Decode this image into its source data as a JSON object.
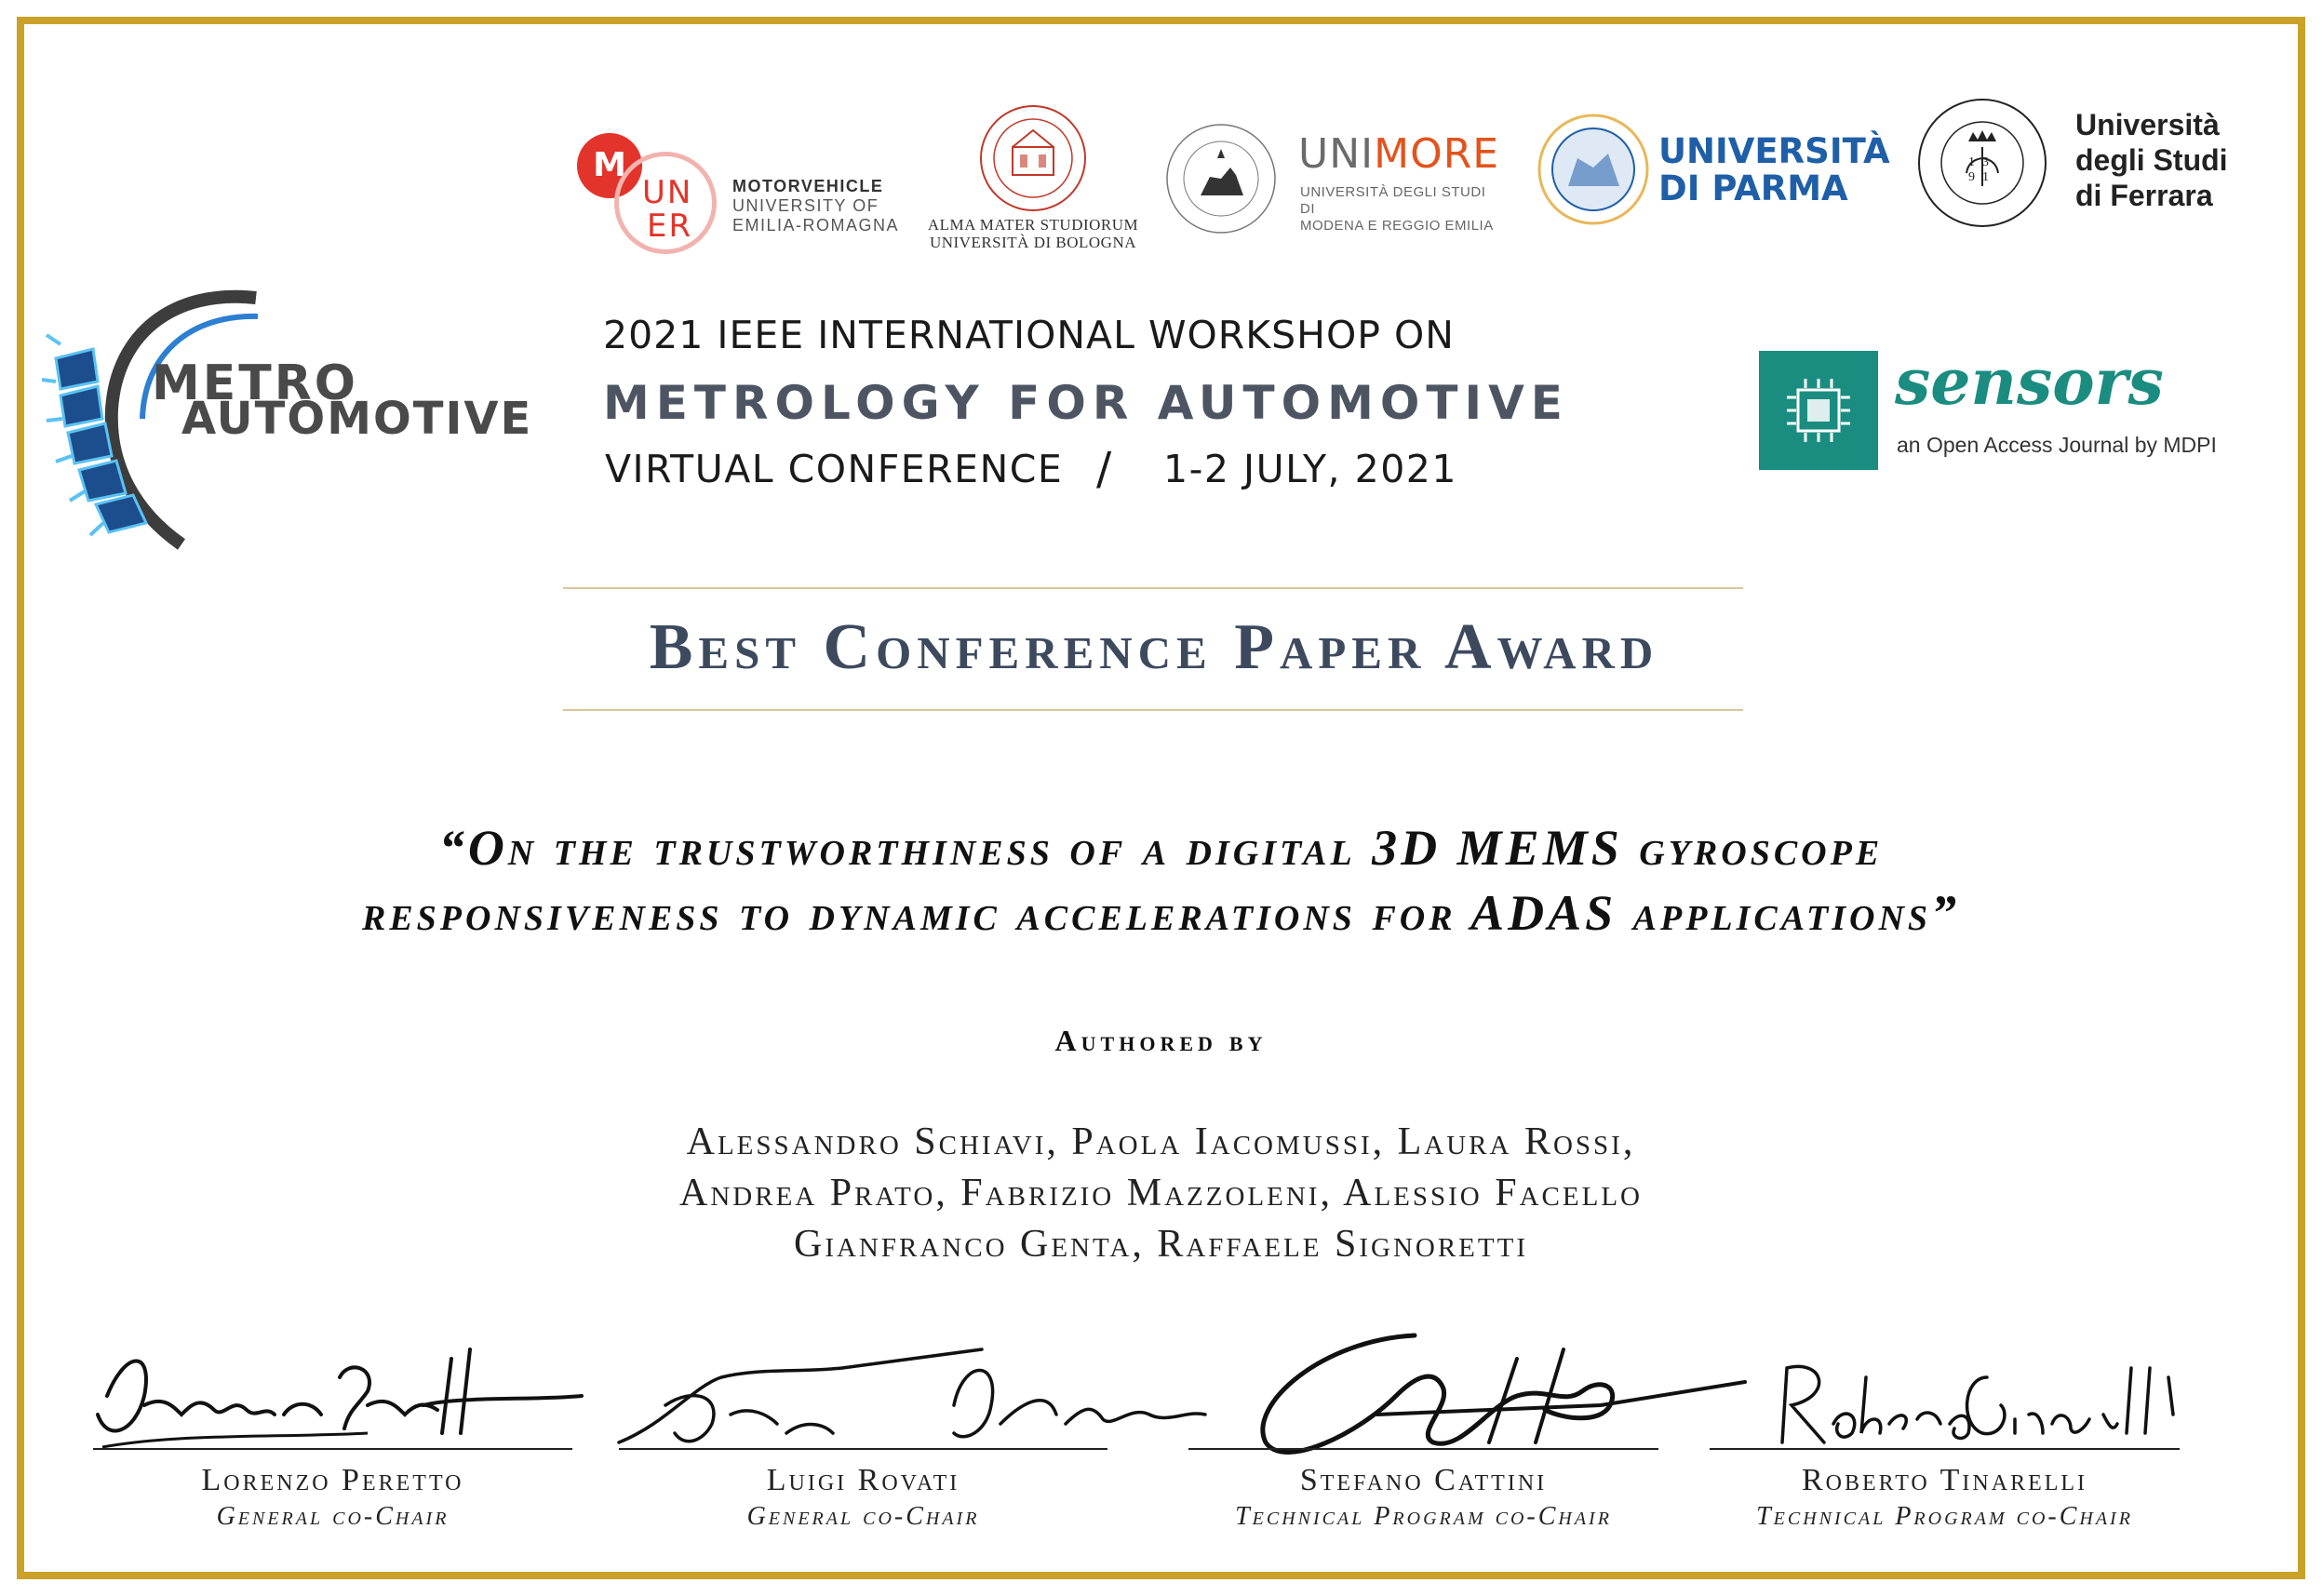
{
  "logos": {
    "muner": {
      "letter_m": "M",
      "letters_un": "UN",
      "letters_er": "ER",
      "text": [
        "MOTORVEHICLE",
        "UNIVERSITY OF",
        "EMILIA-ROMAGNA"
      ]
    },
    "bologna": {
      "text": [
        "ALMA MATER STUDIORUM",
        "UNIVERSITÀ DI BOLOGNA"
      ]
    },
    "unimore": {
      "name_uni": "UNI",
      "name_more": "MORE",
      "text": [
        "UNIVERSITÀ DEGLI STUDI DI",
        "MODENA E REGGIO EMILIA"
      ]
    },
    "parma": {
      "text": [
        "UNIVERSITÀ",
        "DI PARMA"
      ]
    },
    "ferrara": {
      "seal_text": "13 91",
      "text": [
        "Università",
        "degli Studi",
        "di Ferrara"
      ]
    },
    "metro": {
      "line1": "METRO",
      "line2": "AUTOMOTIVE"
    },
    "sensors": {
      "name": "sensors",
      "tagline": "an Open Access Journal by MDPI"
    }
  },
  "workshop": {
    "line1": "2021 IEEE INTERNATIONAL WORKSHOP ON",
    "line2": "METROLOGY FOR AUTOMOTIVE",
    "line3_left": "VIRTUAL CONFERENCE",
    "line3_sep": "/",
    "line3_right": "1-2 JULY, 2021"
  },
  "award_title": "Best Conference Paper Award",
  "paper_title": {
    "line1": "“On the trustworthiness of a digital 3D MEMS gyroscope",
    "line2": "responsiveness to dynamic accelerations for ADAS applications”"
  },
  "authored_by": "Authored by",
  "authors": [
    "Alessandro Schiavi, Paola Iacomussi, Laura Rossi,",
    "Andrea Prato, Fabrizio Mazzoleni, Alessio Facello",
    "Gianfranco Genta, Raffaele Signoretti"
  ],
  "signatures": [
    {
      "name": "Lorenzo Peretto",
      "role": "General co-Chair",
      "signature": "Lorenzo Peretto"
    },
    {
      "name": "Luigi Rovati",
      "role": "General co-Chair",
      "signature": "Luigi Rovati"
    },
    {
      "name": "Stefano Cattini",
      "role": "Technical Program co-Chair",
      "signature": "Stefano Cattini"
    },
    {
      "name": "Roberto Tinarelli",
      "role": "Technical Program co-Chair",
      "signature": "Roberto Tinarelli"
    }
  ],
  "colors": {
    "frame": "#c9a227",
    "title": "#3d4a5e",
    "sensors_teal": "#138a7e",
    "muner_red": "#e2342b",
    "parma_blue": "#1f5fa8"
  }
}
